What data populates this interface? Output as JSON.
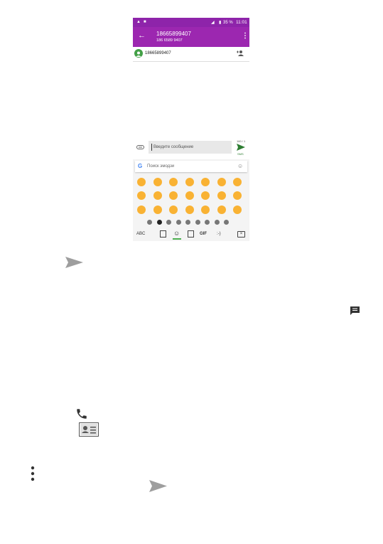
{
  "status_bar": {
    "battery": "35 %",
    "time": "11:01"
  },
  "conversation": {
    "title": "18665899407",
    "subtitle": "186 6589 9407",
    "recipient_chip": "18665899407"
  },
  "compose": {
    "placeholder": "Введите сообщение",
    "char_count": "160 / 1",
    "send_label": "SMS"
  },
  "keyboard": {
    "search_placeholder": "Поиск эмодзи",
    "abc_label": "ABC",
    "gif_label": "GIF",
    "emoticon_label": ":-)"
  },
  "icons": [
    "send-icon",
    "message-icon",
    "phone-icon",
    "contact-card-icon",
    "more-vert-icon"
  ],
  "colors": {
    "status_bar": "#8e24aa",
    "app_bar": "#9c27b0",
    "avatar": "#43a047",
    "emoji": "#f9b233"
  }
}
